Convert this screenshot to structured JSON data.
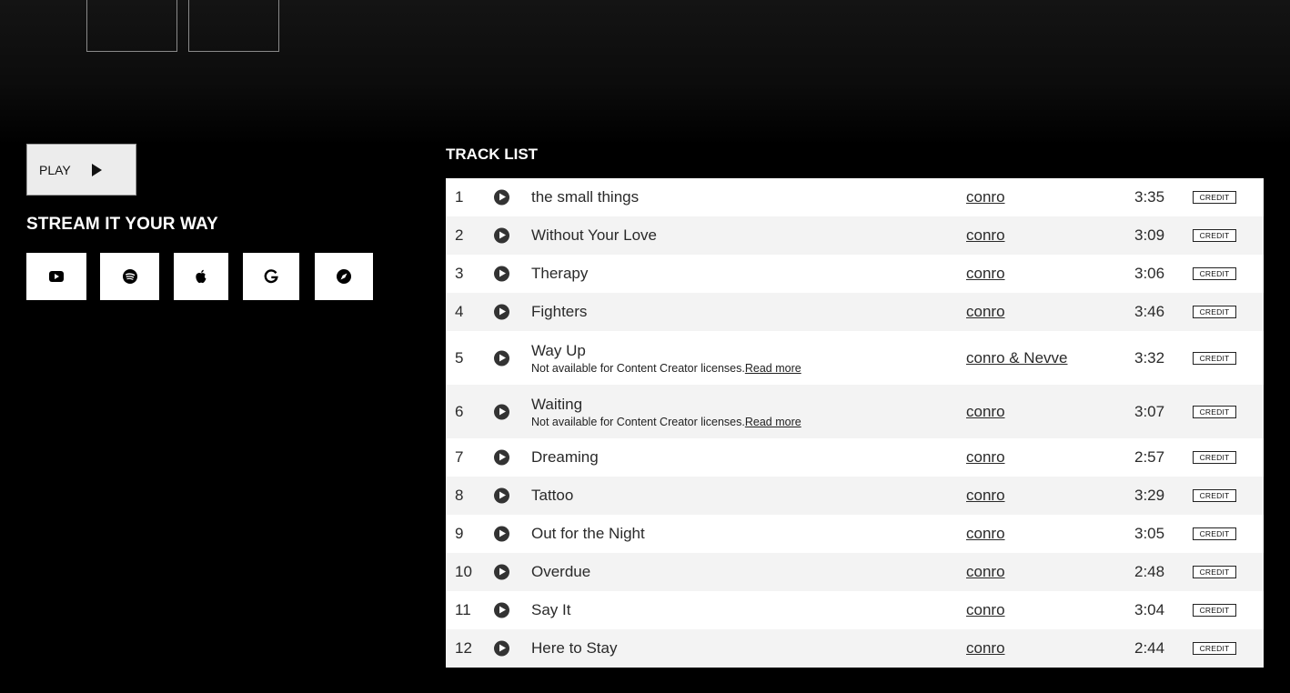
{
  "top_thumbnails": [
    "thumb-1",
    "thumb-2"
  ],
  "play_button": {
    "label": "PLAY",
    "icon": "play-icon"
  },
  "stream": {
    "title": "STREAM IT YOUR WAY",
    "services": [
      {
        "name": "youtube",
        "icon": "youtube-icon"
      },
      {
        "name": "spotify",
        "icon": "spotify-icon"
      },
      {
        "name": "apple-music",
        "icon": "apple-icon"
      },
      {
        "name": "google-play",
        "icon": "google-icon"
      },
      {
        "name": "deezer",
        "icon": "compass-icon"
      }
    ]
  },
  "tracklist": {
    "title": "TRACK LIST",
    "credit_label": "CREDIT",
    "tracks": [
      {
        "num": "1",
        "title": "the small things",
        "artist": "conro",
        "duration": "3:35"
      },
      {
        "num": "2",
        "title": "Without Your Love",
        "artist": "conro",
        "duration": "3:09"
      },
      {
        "num": "3",
        "title": "Therapy",
        "artist": "conro",
        "duration": "3:06"
      },
      {
        "num": "4",
        "title": "Fighters",
        "artist": "conro",
        "duration": "3:46"
      },
      {
        "num": "5",
        "title": "Way Up",
        "artist": "conro & Nevve",
        "duration": "3:32",
        "note": "Not available for Content Creator licenses.",
        "note_link": "Read more"
      },
      {
        "num": "6",
        "title": "Waiting",
        "artist": "conro",
        "duration": "3:07",
        "note": "Not available for Content Creator licenses.",
        "note_link": "Read more"
      },
      {
        "num": "7",
        "title": "Dreaming",
        "artist": "conro",
        "duration": "2:57"
      },
      {
        "num": "8",
        "title": "Tattoo",
        "artist": "conro",
        "duration": "3:29"
      },
      {
        "num": "9",
        "title": "Out for the Night",
        "artist": "conro",
        "duration": "3:05"
      },
      {
        "num": "10",
        "title": "Overdue",
        "artist": "conro",
        "duration": "2:48"
      },
      {
        "num": "11",
        "title": "Say It",
        "artist": "conro",
        "duration": "3:04"
      },
      {
        "num": "12",
        "title": "Here to Stay",
        "artist": "conro",
        "duration": "2:44"
      }
    ]
  }
}
